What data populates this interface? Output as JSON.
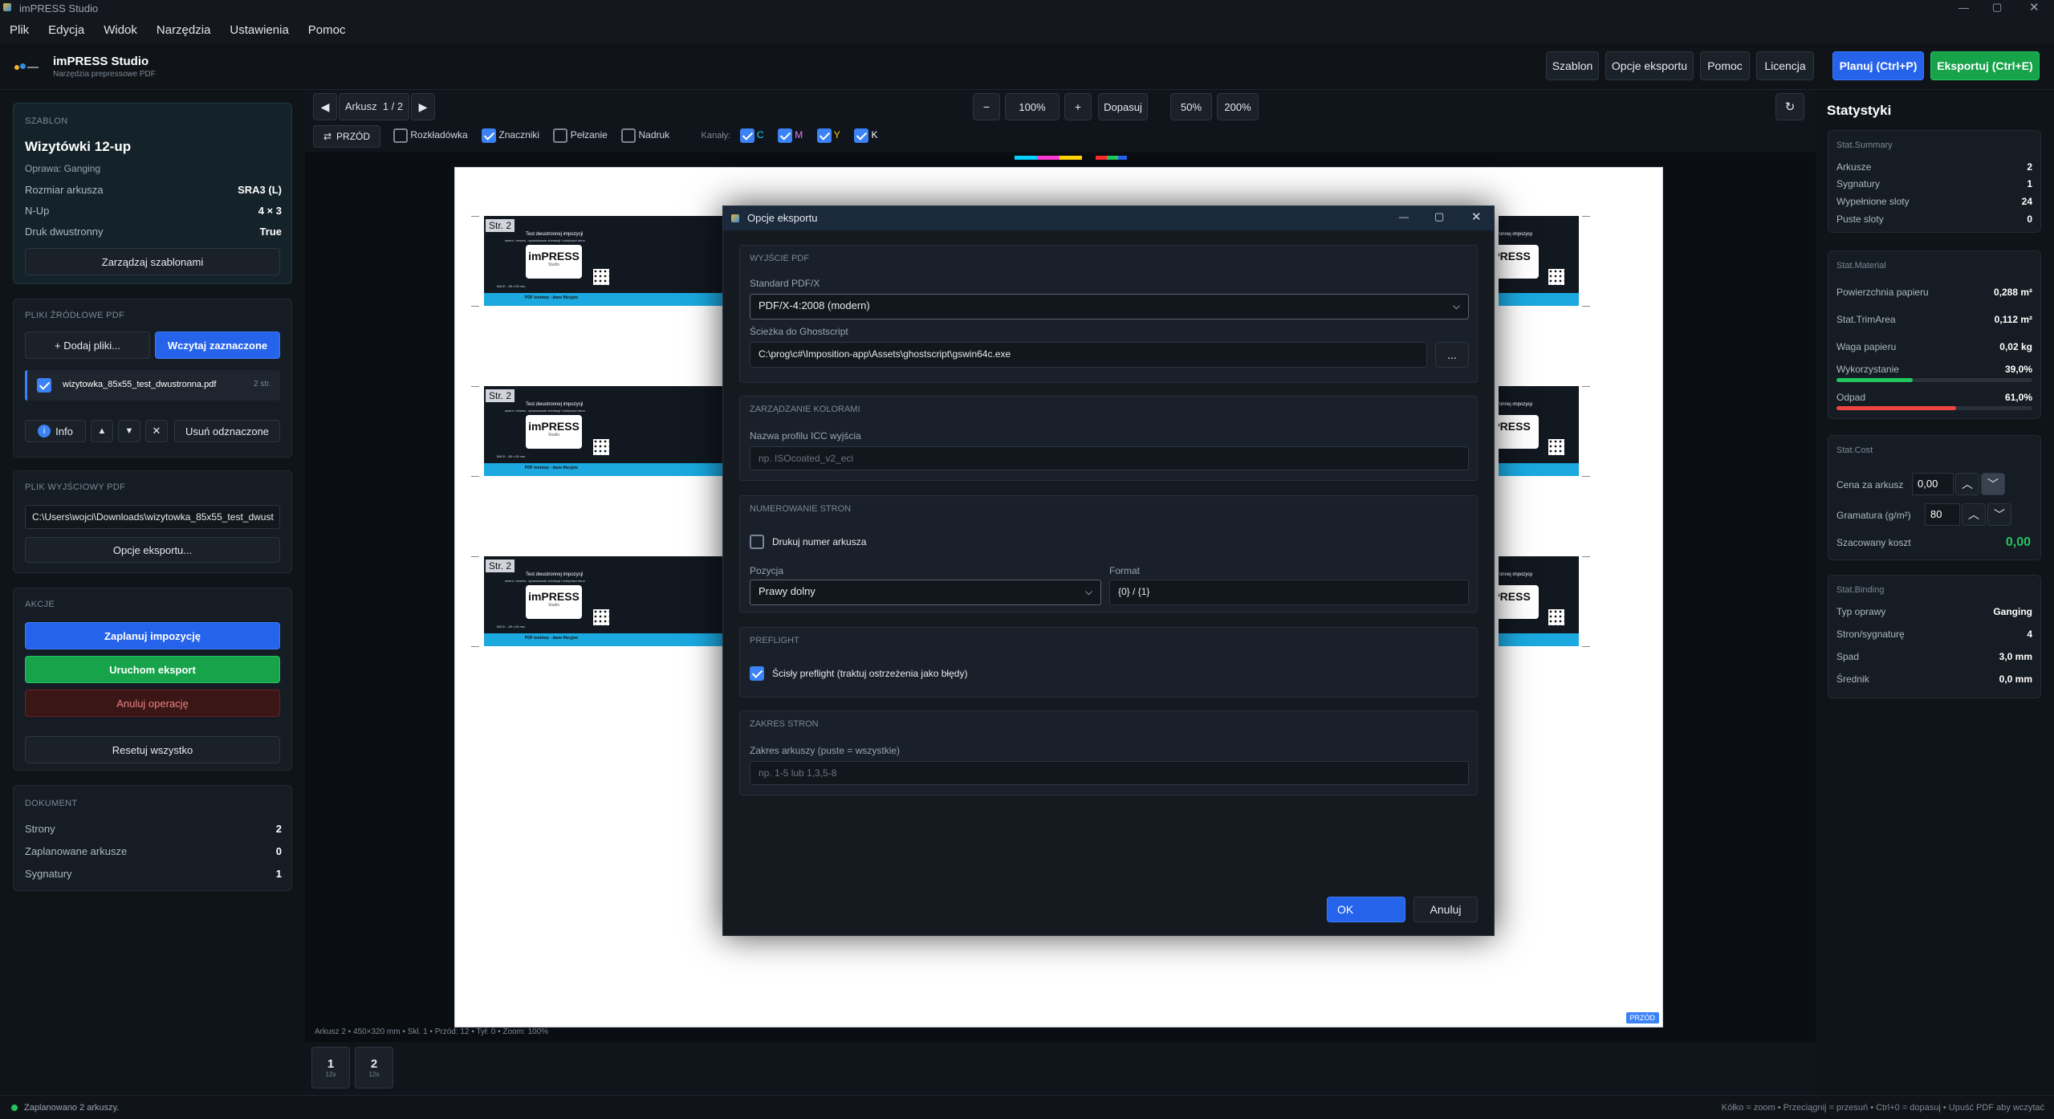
{
  "window": {
    "title": "imPRESS Studio"
  },
  "menu": [
    "Plik",
    "Edycja",
    "Widok",
    "Narzędzia",
    "Ustawienia",
    "Pomoc"
  ],
  "header": {
    "app_name": "imPRESS Studio",
    "app_sub": "Narzędzia prepressowe PDF",
    "buttons": {
      "szablon": "Szablon",
      "opcje": "Opcje eksportu",
      "pomoc": "Pomoc",
      "licencja": "Licencja",
      "planuj": "Planuj (Ctrl+P)",
      "eksportuj": "Eksportuj (Ctrl+E)"
    }
  },
  "template": {
    "section": "SZABLON",
    "name": "Wizytówki 12-up",
    "binding": "Oprawa: Ganging",
    "rows": [
      {
        "label": "Rozmiar arkusza",
        "value": "SRA3 (L)"
      },
      {
        "label": "N-Up",
        "value": "4 × 3"
      },
      {
        "label": "Druk dwustronny",
        "value": "True"
      }
    ],
    "manage": "Zarządzaj szablonami"
  },
  "sources": {
    "section": "PLIKI ŹRÓDŁOWE PDF",
    "add": "+ Dodaj pliki...",
    "load": "Wczytaj zaznaczone",
    "file": "wizytowka_85x55_test_dwustronna.pdf",
    "pages": "2 str.",
    "info": "Info",
    "remove": "Usuń odznaczone"
  },
  "output": {
    "section": "PLIK WYJŚCIOWY PDF",
    "path": "C:\\Users\\wojci\\Downloads\\wizytowka_85x55_test_dwust",
    "options": "Opcje eksportu..."
  },
  "actions": {
    "section": "AKCJE",
    "plan": "Zaplanuj impozycję",
    "run": "Uruchom eksport",
    "cancel": "Anuluj operację",
    "reset": "Resetuj wszystko"
  },
  "document": {
    "section": "DOKUMENT",
    "rows": [
      {
        "label": "Strony",
        "value": "2"
      },
      {
        "label": "Zaplanowane arkusze",
        "value": "0"
      },
      {
        "label": "Sygnatury",
        "value": "1"
      }
    ]
  },
  "toolbar": {
    "sheet_label": "Arkusz",
    "sheet_current": "1",
    "sheet_sep": "/",
    "sheet_total": "2",
    "zoom": "100%",
    "fit": "Dopasuj",
    "z50": "50%",
    "z200": "200%",
    "front": "PRZÓD",
    "rozkladowka": "Rozkładówka",
    "znaczniki": "Znaczniki",
    "pelzanie": "Pełzanie",
    "nadruk": "Nadruk",
    "kanaly": "Kanały:",
    "c": "C",
    "m": "M",
    "y": "Y",
    "k": "K",
    "minus": "−",
    "plus": "+",
    "refresh": "↻"
  },
  "canvas": {
    "page_label": "Str. 2",
    "card_title": "Test dwustronnej impozycji",
    "card_sub": "awers / rewers - sprawdzanie orientacji i kolejności stron",
    "logo": "imPRESS",
    "logo_sub": "Studio",
    "back": "BACK - 85 x 55 mm",
    "footer": "PDF testowy - dane fikcyjne",
    "badge": "PRZÓD",
    "status": "Arkusz 2  •  450×320 mm  •  Skl. 1  •  Przód: 12  •  Tył: 0  •  Zoom: 100%",
    "thumbs": [
      {
        "n": "1",
        "s": "12s"
      },
      {
        "n": "2",
        "s": "12s"
      }
    ]
  },
  "dialog": {
    "title": "Opcje eksportu",
    "pdf": {
      "section": "WYJŚCIE PDF",
      "std_label": "Standard PDF/X",
      "std_value": "PDF/X-4:2008 (modern)",
      "gs_label": "Ścieżka do Ghostscript",
      "gs_value": "C:\\prog\\c#\\Imposition-app\\Assets\\ghostscript\\gswin64c.exe",
      "browse": "..."
    },
    "color": {
      "section": "ZARZĄDZANIE KOLORAMI",
      "icc_label": "Nazwa profilu ICC wyjścia",
      "icc_placeholder": "np. ISOcoated_v2_eci"
    },
    "numbering": {
      "section": "NUMEROWANIE STRON",
      "print_label": "Drukuj numer arkusza",
      "pos_label": "Pozycja",
      "pos_value": "Prawy dolny",
      "fmt_label": "Format",
      "fmt_value": "{0} / {1}"
    },
    "preflight": {
      "section": "PREFLIGHT",
      "strict_label": "Ścisły preflight (traktuj ostrzeżenia jako błędy)"
    },
    "range": {
      "section": "ZAKRES STRON",
      "label": "Zakres arkuszy (puste = wszystkie)",
      "placeholder": "np. 1-5 lub 1,3,5-8"
    },
    "ok": "OK",
    "cancel": "Anuluj"
  },
  "stats": {
    "title": "Statystyki",
    "summary": {
      "section": "Stat.Summary",
      "rows": [
        {
          "label": "Arkusze",
          "value": "2"
        },
        {
          "label": "Sygnatury",
          "value": "1"
        },
        {
          "label": "Wypełnione sloty",
          "value": "24"
        },
        {
          "label": "Puste sloty",
          "value": "0"
        }
      ]
    },
    "material": {
      "section": "Stat.Material",
      "area_label": "Powierzchnia papieru",
      "area": "0,288 m²",
      "trim_label": "Stat.TrimArea",
      "trim": "0,112 m²",
      "weight_label": "Waga papieru",
      "weight": "0,02 kg",
      "usage_label": "Wykorzystanie",
      "usage": "39,0%",
      "usage_frac": 0.39,
      "waste_label": "Odpad",
      "waste": "61,0%",
      "waste_frac": 0.61
    },
    "cost": {
      "section": "Stat.Cost",
      "price_label": "Cena za arkusz",
      "price": "0,00",
      "gram_label": "Gramatura (g/m²)",
      "gram": "80",
      "est_label": "Szacowany koszt",
      "est": "0,00"
    },
    "binding": {
      "section": "Stat.Binding",
      "rows": [
        {
          "label": "Typ oprawy",
          "value": "Ganging"
        },
        {
          "label": "Stron/sygnaturę",
          "value": "4"
        },
        {
          "label": "Spad",
          "value": "3,0 mm"
        },
        {
          "label": "Średnik",
          "value": "0,0 mm"
        }
      ]
    }
  },
  "statusbar": {
    "left": "Zaplanowano 2 arkuszy.",
    "right": "Kółko = zoom  •  Przeciągnij = przesuń  •  Ctrl+0 = dopasuj  •  Upuść PDF aby wczytać"
  },
  "colors": {
    "accent": "#2563eb",
    "green": "#16a34a",
    "cyan": "#1ba9e0",
    "bg": "#0f1419"
  }
}
